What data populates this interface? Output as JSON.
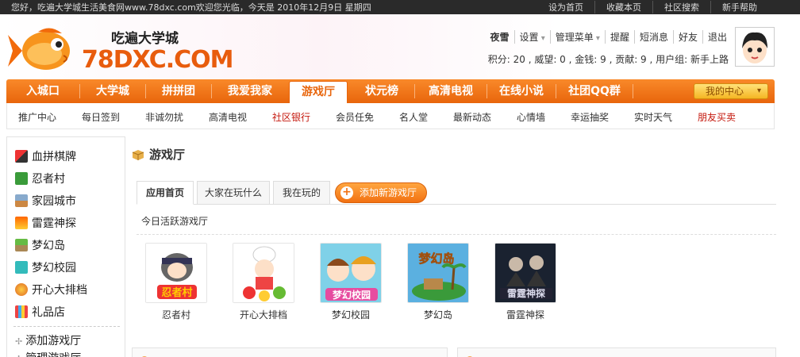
{
  "topbar": {
    "welcome": "您好，吃遍大学城生活美食网www.78dxc.com欢迎您光临，今天是 2010年12月9日 星期四",
    "links": [
      "设为首页",
      "收藏本页",
      "社区搜索",
      "新手帮助"
    ]
  },
  "logo": {
    "name": "78DXC.COM",
    "tagline": "吃遍大学城"
  },
  "user": {
    "name": "夜雪",
    "menu": [
      "设置",
      "管理菜单",
      "提醒",
      "短消息",
      "好友",
      "退出"
    ],
    "stats": "积分: 20 , 威望: 0 , 金钱: 9 , 贡献: 9 , 用户组: 新手上路"
  },
  "mainnav": {
    "tabs": [
      "入城口",
      "大学城",
      "拼拼团",
      "我爱我家",
      "游戏厅",
      "状元榜",
      "高清电视",
      "在线小说",
      "社团QQ群"
    ],
    "active": "游戏厅",
    "mycenter": "我的中心"
  },
  "subnav": {
    "items": [
      "推广中心",
      "每日签到",
      "非诚勿扰",
      "高清电视",
      "社区银行",
      "会员任免",
      "名人堂",
      "最新动态",
      "心情墙",
      "幸运抽奖",
      "实时天气",
      "朋友买卖"
    ]
  },
  "sidebar": {
    "games": [
      "血拼棋牌",
      "忍者村",
      "家园城市",
      "雷霆神探",
      "梦幻岛",
      "梦幻校园",
      "开心大排档",
      "礼品店"
    ],
    "links": [
      "添加游戏厅",
      "管理游戏厅"
    ]
  },
  "main": {
    "title": "游戏厅",
    "tabs": [
      "应用首页",
      "大家在玩什么",
      "我在玩的"
    ],
    "add_button": "添加新游戏厅",
    "section_label": "今日活跃游戏厅",
    "games": [
      "忍者村",
      "开心大排档",
      "梦幻校园",
      "梦幻岛",
      "雷霆神探"
    ]
  },
  "colors": {
    "accent": "#e8650c",
    "highlight_red": "#c4160b"
  }
}
